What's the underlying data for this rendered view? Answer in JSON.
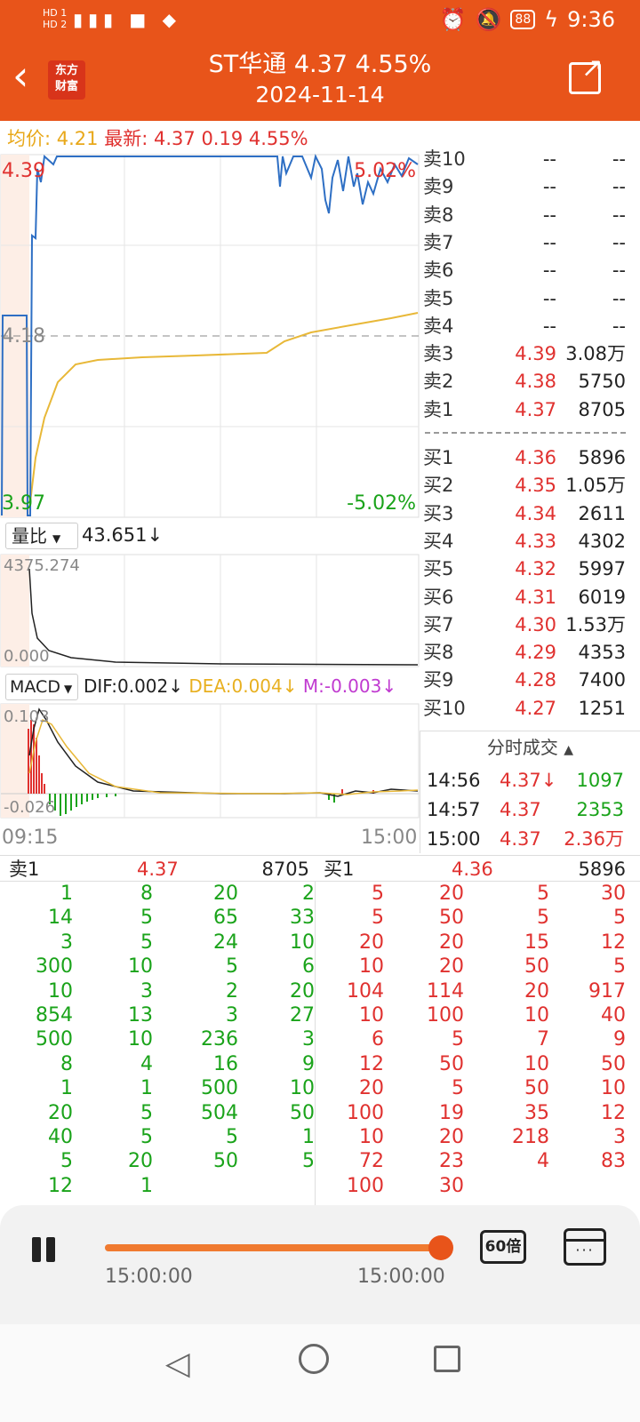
{
  "status_bar": {
    "sim": "HD 1\nHD 2",
    "signal": "4G 5G",
    "battery": "88",
    "time": "9:36"
  },
  "header": {
    "logo": "东方\n财富",
    "title": "ST华通  4.37  4.55%",
    "date": "2024-11-14"
  },
  "summary": {
    "avg_label": "均价:",
    "avg_value": "4.21",
    "latest_label": "最新:",
    "latest_value": "4.37",
    "change": "0.19",
    "change_pct": "4.55%"
  },
  "price_chart": {
    "top_price": "4.39",
    "top_pct": "5.02%",
    "mid_price": "4.18",
    "bottom_price": "3.97",
    "bottom_pct": "-5.02%",
    "time_start": "09:15",
    "time_end": "15:00"
  },
  "volume_panel": {
    "selector": "量比",
    "value": "43.651↓",
    "max": "4375.274",
    "min": "0.000"
  },
  "macd_panel": {
    "selector": "MACD",
    "dif": "DIF:0.002↓",
    "dea": "DEA:0.004↓",
    "m": "M:-0.003↓",
    "max": "0.103",
    "min": "-0.026"
  },
  "colors": {
    "orange": "#e8541a",
    "up": "#e0312f",
    "down": "#1aa31a",
    "price_line": "#2e6fc4",
    "avg_line": "#e8b838",
    "dea_line": "#e8b838"
  },
  "order_book": {
    "asks": [
      {
        "label": "卖10",
        "price": "--",
        "vol": "--"
      },
      {
        "label": "卖9",
        "price": "--",
        "vol": "--"
      },
      {
        "label": "卖8",
        "price": "--",
        "vol": "--"
      },
      {
        "label": "卖7",
        "price": "--",
        "vol": "--"
      },
      {
        "label": "卖6",
        "price": "--",
        "vol": "--"
      },
      {
        "label": "卖5",
        "price": "--",
        "vol": "--"
      },
      {
        "label": "卖4",
        "price": "--",
        "vol": "--"
      },
      {
        "label": "卖3",
        "price": "4.39",
        "vol": "3.08万"
      },
      {
        "label": "卖2",
        "price": "4.38",
        "vol": "5750"
      },
      {
        "label": "卖1",
        "price": "4.37",
        "vol": "8705"
      }
    ],
    "bids": [
      {
        "label": "买1",
        "price": "4.36",
        "vol": "5896"
      },
      {
        "label": "买2",
        "price": "4.35",
        "vol": "1.05万"
      },
      {
        "label": "买3",
        "price": "4.34",
        "vol": "2611"
      },
      {
        "label": "买4",
        "price": "4.33",
        "vol": "4302"
      },
      {
        "label": "买5",
        "price": "4.32",
        "vol": "5997"
      },
      {
        "label": "买6",
        "price": "4.31",
        "vol": "6019"
      },
      {
        "label": "买7",
        "price": "4.30",
        "vol": "1.53万"
      },
      {
        "label": "买8",
        "price": "4.29",
        "vol": "4353"
      },
      {
        "label": "买9",
        "price": "4.28",
        "vol": "7400"
      },
      {
        "label": "买10",
        "price": "4.27",
        "vol": "1251"
      }
    ]
  },
  "ticks": {
    "title": "分时成交",
    "rows": [
      {
        "time": "14:56",
        "price": "4.37↓",
        "vol": "1097"
      },
      {
        "time": "14:57",
        "price": "4.37",
        "vol": "2353"
      },
      {
        "time": "15:00",
        "price": "4.37",
        "vol": "2.36万"
      }
    ]
  },
  "queue": {
    "ask_label": "卖1",
    "ask_price": "4.37",
    "ask_vol": "8705",
    "bid_label": "买1",
    "bid_price": "4.36",
    "bid_vol": "5896",
    "ask_rows": [
      [
        "1",
        "8",
        "20",
        "2"
      ],
      [
        "14",
        "5",
        "65",
        "33"
      ],
      [
        "3",
        "5",
        "24",
        "10"
      ],
      [
        "300",
        "10",
        "5",
        "6"
      ],
      [
        "10",
        "3",
        "2",
        "20"
      ],
      [
        "854",
        "13",
        "3",
        "27"
      ],
      [
        "500",
        "10",
        "236",
        "3"
      ],
      [
        "8",
        "4",
        "16",
        "9"
      ],
      [
        "1",
        "1",
        "500",
        "10"
      ],
      [
        "20",
        "5",
        "504",
        "50"
      ],
      [
        "40",
        "5",
        "5",
        "1"
      ],
      [
        "5",
        "20",
        "50",
        "5"
      ],
      [
        "12",
        "1",
        "",
        ""
      ]
    ],
    "bid_rows": [
      [
        "5",
        "20",
        "5",
        "30"
      ],
      [
        "5",
        "50",
        "5",
        "5"
      ],
      [
        "20",
        "20",
        "15",
        "12"
      ],
      [
        "10",
        "20",
        "50",
        "5"
      ],
      [
        "104",
        "114",
        "20",
        "917"
      ],
      [
        "10",
        "100",
        "10",
        "40"
      ],
      [
        "6",
        "5",
        "7",
        "9"
      ],
      [
        "12",
        "50",
        "10",
        "50"
      ],
      [
        "20",
        "5",
        "50",
        "10"
      ],
      [
        "100",
        "19",
        "35",
        "12"
      ],
      [
        "10",
        "20",
        "218",
        "3"
      ],
      [
        "72",
        "23",
        "4",
        "83"
      ],
      [
        "100",
        "30",
        "",
        ""
      ]
    ]
  },
  "player": {
    "start_time": "15:00:00",
    "end_time": "15:00:00",
    "speed": "60倍",
    "progress": 1.0
  }
}
